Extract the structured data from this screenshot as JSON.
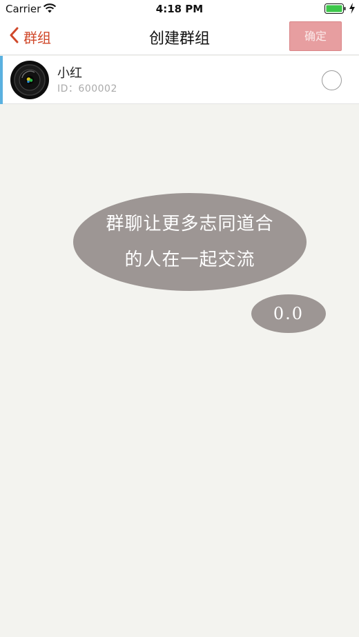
{
  "status_bar": {
    "carrier": "Carrier",
    "time": "4:18 PM",
    "icons": [
      "wifi-icon",
      "battery-icon",
      "charging-icon"
    ]
  },
  "nav": {
    "back_label": "群组",
    "title": "创建群组",
    "confirm_label": "确定"
  },
  "contacts": [
    {
      "name": "小红",
      "id_text": "ID：600002",
      "avatar": "camera-lens-avatar",
      "selected": false
    }
  ],
  "empty_state": {
    "line1": "群聊让更多志同道合",
    "line2": "的人在一起交流",
    "face": "0.0"
  },
  "colors": {
    "accent_red": "#d0482a",
    "confirm_bg": "#e79ea0",
    "selection_bar": "#5ab1e0",
    "bubble_gray": "#9d9694",
    "page_bg": "#f3f3ef"
  }
}
